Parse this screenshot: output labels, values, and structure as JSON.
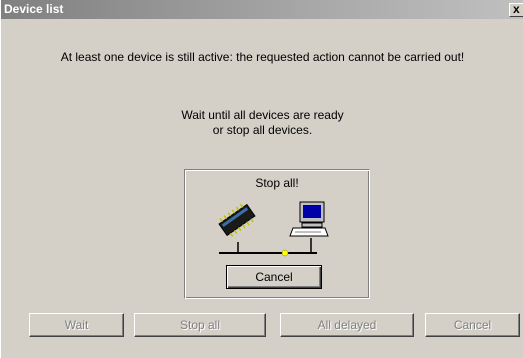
{
  "window": {
    "title": "Device list",
    "close_label": "x"
  },
  "message": "At least one device is still active: the requested action cannot be carried out!",
  "instruction": {
    "line1": "Wait until all devices are ready",
    "line2": "or stop all devices."
  },
  "panel": {
    "title": "Stop all!",
    "cancel_label": "Cancel"
  },
  "buttons": {
    "wait": "Wait",
    "stop_all": "Stop all",
    "all_delayed": "All delayed",
    "cancel": "Cancel"
  },
  "colors": {
    "dialog_bg": "#d4d0c8",
    "titlebar_start": "#808080",
    "titlebar_end": "#c0c0c0",
    "chip": "#1a1a1a",
    "chip_highlight": "#3a6ea5",
    "monitor_screen": "#0000a8",
    "network_node": "#ffff00"
  }
}
